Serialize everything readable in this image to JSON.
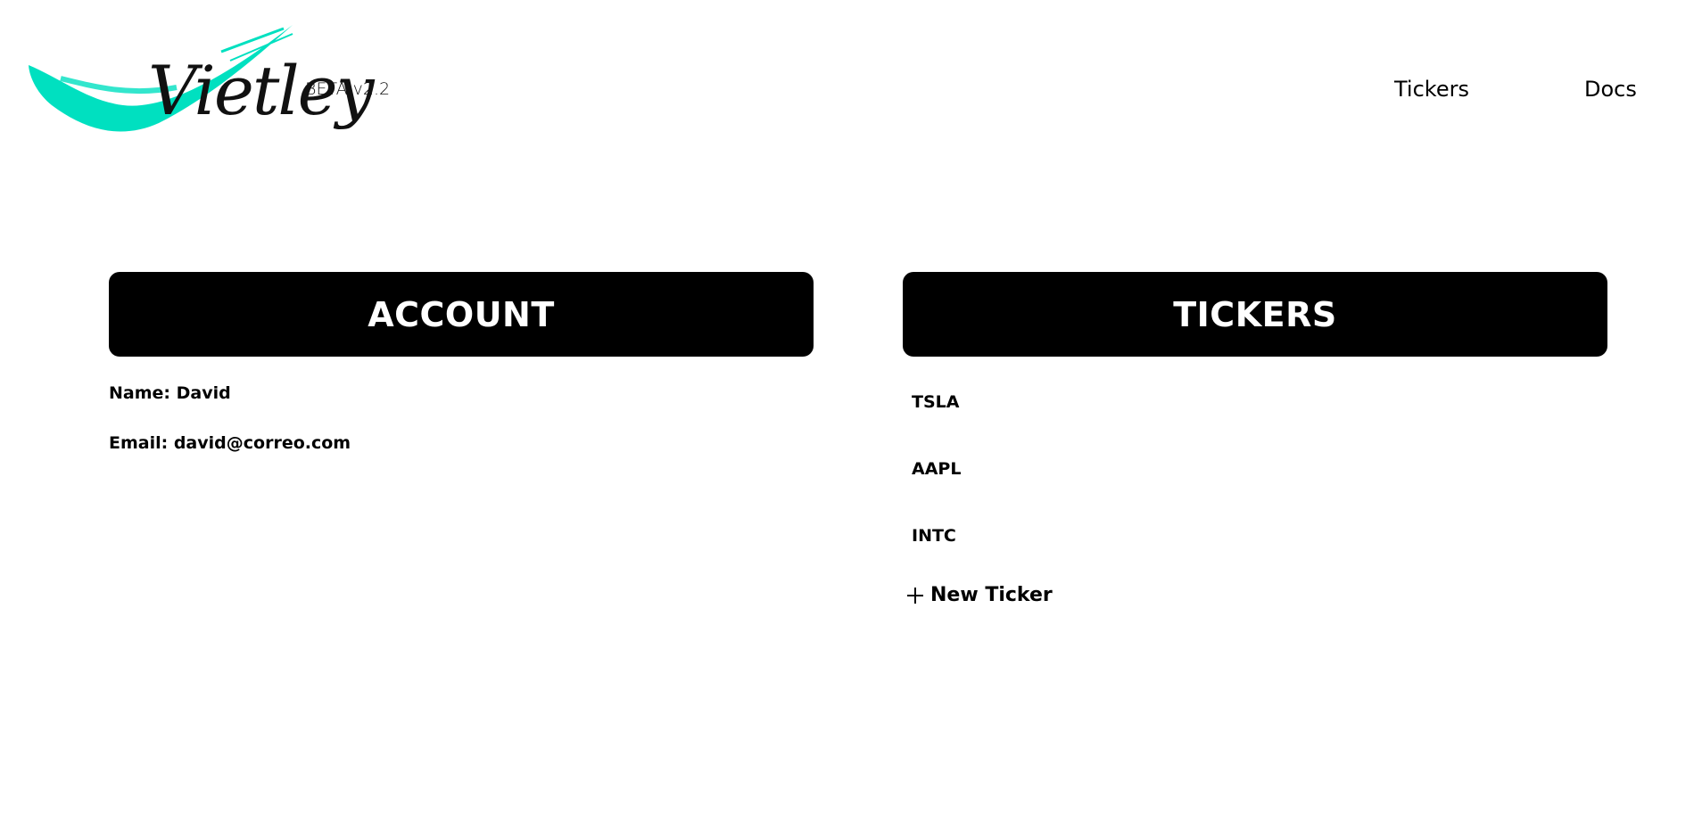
{
  "header": {
    "logo_text": "Vietley",
    "version": "BETA v2.2",
    "nav": {
      "tickers": "Tickers",
      "docs": "Docs"
    }
  },
  "account": {
    "title": "ACCOUNT",
    "name_line": "Name: David",
    "email_line": "Email: david@correo.com"
  },
  "tickers": {
    "title": "TICKERS",
    "items": [
      "TSLA",
      "AAPL",
      "INTC"
    ],
    "new_label": "New Ticker"
  },
  "colors": {
    "brand_accent": "#00e0c0",
    "panel_header_bg": "#000000",
    "panel_header_text": "#ffffff"
  },
  "icons": {
    "logo": "brush-stroke-logo",
    "new_ticker": "plus-icon"
  }
}
